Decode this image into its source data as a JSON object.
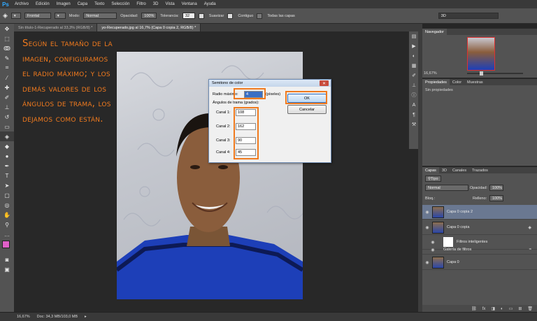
{
  "menubar": {
    "logo": "Ps",
    "items": [
      "Archivo",
      "Edición",
      "Imagen",
      "Capa",
      "Texto",
      "Selección",
      "Filtro",
      "3D",
      "Vista",
      "Ventana",
      "Ayuda"
    ]
  },
  "options": {
    "mode_select": "Frontal",
    "modo_label": "Modo:",
    "modo_value": "Normal",
    "opacidad_label": "Opacidad:",
    "opacidad_value": "100%",
    "tolerancia_label": "Tolerancia:",
    "tolerancia_value": "32",
    "suavizar": "Suavizar",
    "contiguo": "Contiguo",
    "todas_capas": "Todas las capas",
    "workspace": "3D"
  },
  "tabs": [
    "Sin título-1-Recuperado al 33,3% (RGB/8) *",
    "yo-Recuperado.jpg al 16,7% (Capa 0 copia 2, RGB/8) *"
  ],
  "overlay_text": "Según el tamaño de la imagen, configuramos el radio máximo; y los demás valores de los ángulos de trama, los dejamos como están.",
  "dialog": {
    "title": "Semitono de color",
    "radio_label": "Radio máximo:",
    "radio_value": "4",
    "radio_unit": "(píxeles)",
    "angulos_label": "Ángulos de trama (grados):",
    "canales": [
      {
        "label": "Canal 1:",
        "value": "108"
      },
      {
        "label": "Canal 2:",
        "value": "162"
      },
      {
        "label": "Canal 3:",
        "value": "90"
      },
      {
        "label": "Canal 4:",
        "value": "45"
      }
    ],
    "ok": "OK",
    "cancel": "Cancelar"
  },
  "navigator": {
    "title": "Navegador",
    "zoom": "16,67%"
  },
  "properties": {
    "tabs": [
      "Propiedades",
      "Color",
      "Muestras"
    ],
    "empty": "Sin propiedades"
  },
  "layers": {
    "tabs": [
      "Capas",
      "3D",
      "Canales",
      "Trazados"
    ],
    "filter": "Tipo",
    "blend": "Normal",
    "opacity_label": "Opacidad:",
    "opacity_value": "100%",
    "lock_label": "Bloq.:",
    "fill_label": "Relleno:",
    "fill_value": "100%",
    "items": [
      "Capa 0 copia 2",
      "Capa 0 copia",
      "Filtros inteligentes",
      "Galería de filtros",
      "Capa 0"
    ]
  },
  "status": {
    "zoom": "16,67%",
    "doc": "Doc: 34,3 MB/103,0 MB"
  },
  "colors": {
    "accent": "#f07a1e",
    "ps_blue": "#31a8ff",
    "foreground_swatch": "#e060c8",
    "background_swatch": "#ffffff"
  }
}
